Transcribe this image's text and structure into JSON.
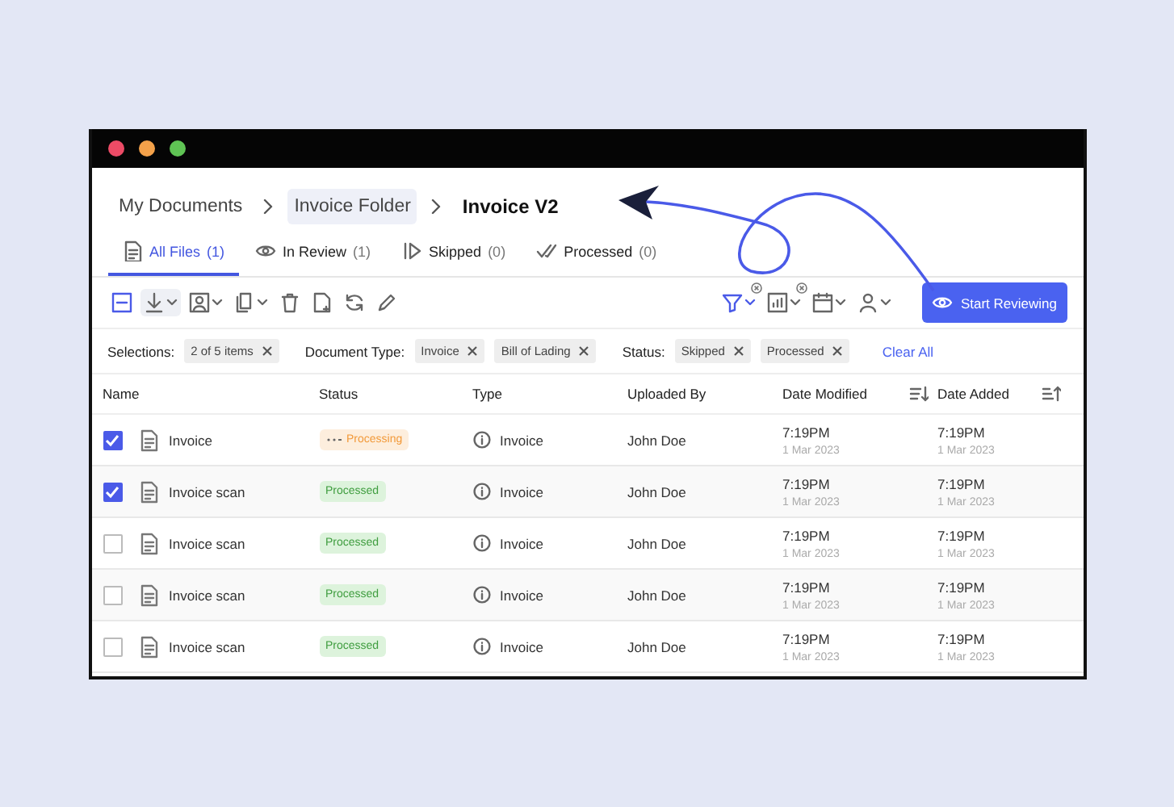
{
  "breadcrumb": [
    {
      "label": "My Documents",
      "kind": "link"
    },
    {
      "label": "Invoice Folder",
      "kind": "hover"
    },
    {
      "label": "Invoice V2",
      "kind": "current"
    }
  ],
  "tabs": [
    {
      "label": "All Files",
      "count": "(1)",
      "selected": true
    },
    {
      "label": "In Review",
      "count": "(1)",
      "selected": false
    },
    {
      "label": "Skipped",
      "count": "(0)",
      "selected": false
    },
    {
      "label": "Processed",
      "count": "(0)",
      "selected": false
    }
  ],
  "toolbar": {
    "primary_button": "Start Reviewing"
  },
  "filters": [
    {
      "label": "Selections:",
      "chips": [
        "2 of 5 items"
      ]
    },
    {
      "label": "Document Type:",
      "chips": [
        "Invoice",
        "Bill of Lading"
      ]
    },
    {
      "label": "Status:",
      "chips": [
        "Skipped",
        "Processed"
      ]
    }
  ],
  "clear_all": "Clear All",
  "table": {
    "columns": [
      "Name",
      "Status",
      "Type",
      "Uploaded By",
      "Date Modified",
      "Date Added"
    ],
    "rows": [
      {
        "checked": true,
        "name": "Invoice",
        "status": "Processing",
        "kind": "processing",
        "type": "Invoice",
        "uploaded_by": "John Doe",
        "modified_time": "7:19PM",
        "modified_date": "1 Mar 2023",
        "added_time": "7:19PM",
        "added_date": "1 Mar 2023"
      },
      {
        "checked": true,
        "name": "Invoice scan",
        "status": "Processed",
        "kind": "processed",
        "type": "Invoice",
        "uploaded_by": "John Doe",
        "modified_time": "7:19PM",
        "modified_date": "1 Mar 2023",
        "added_time": "7:19PM",
        "added_date": "1 Mar 2023"
      },
      {
        "checked": false,
        "name": "Invoice scan",
        "status": "Processed",
        "kind": "processed",
        "type": "Invoice",
        "uploaded_by": "John Doe",
        "modified_time": "7:19PM",
        "modified_date": "1 Mar 2023",
        "added_time": "7:19PM",
        "added_date": "1 Mar 2023"
      },
      {
        "checked": false,
        "name": "Invoice scan",
        "status": "Processed",
        "kind": "processed",
        "type": "Invoice",
        "uploaded_by": "John Doe",
        "modified_time": "7:19PM",
        "modified_date": "1 Mar 2023",
        "added_time": "7:19PM",
        "added_date": "1 Mar 2023"
      },
      {
        "checked": false,
        "name": "Invoice scan",
        "status": "Processed",
        "kind": "processed",
        "type": "Invoice",
        "uploaded_by": "John Doe",
        "modified_time": "7:19PM",
        "modified_date": "1 Mar 2023",
        "added_time": "7:19PM",
        "added_date": "1 Mar 2023"
      }
    ]
  }
}
